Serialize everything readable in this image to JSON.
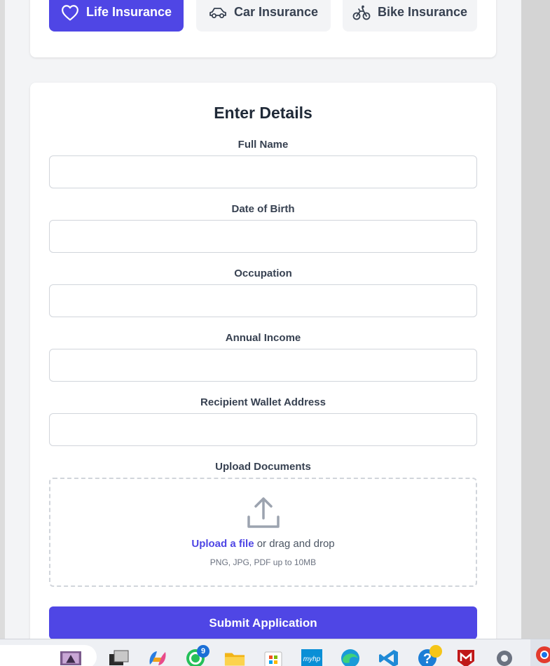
{
  "insurance_tabs": [
    {
      "label": "Life Insurance",
      "icon": "heart-icon",
      "active": true
    },
    {
      "label": "Car Insurance",
      "icon": "car-icon",
      "active": false
    },
    {
      "label": "Bike Insurance",
      "icon": "bike-icon",
      "active": false
    }
  ],
  "form": {
    "title": "Enter Details",
    "fields": [
      {
        "label": "Full Name",
        "value": ""
      },
      {
        "label": "Date of Birth",
        "value": ""
      },
      {
        "label": "Occupation",
        "value": ""
      },
      {
        "label": "Annual Income",
        "value": ""
      },
      {
        "label": "Recipient Wallet Address",
        "value": ""
      }
    ],
    "upload": {
      "label": "Upload Documents",
      "link_text": "Upload a file",
      "rest_text": " or drag and drop",
      "hint": "PNG, JPG, PDF up to 10MB",
      "icon": "upload-icon"
    },
    "submit_label": "Submit Application"
  },
  "taskbar": {
    "apps": [
      "photo-app-icon",
      "task-view-icon",
      "copilot-icon",
      "whatsapp-icon",
      "file-explorer-icon",
      "microsoft-store-icon",
      "myhp-icon",
      "edge-icon",
      "vscode-icon",
      "help-icon",
      "mcafee-icon",
      "settings-icon",
      "chrome-icon"
    ],
    "whatsapp_badge": "9"
  },
  "colors": {
    "accent": "#4f46e5",
    "page_bg": "#f3f4f6",
    "card_bg": "#ffffff",
    "border": "#d1d5db"
  }
}
